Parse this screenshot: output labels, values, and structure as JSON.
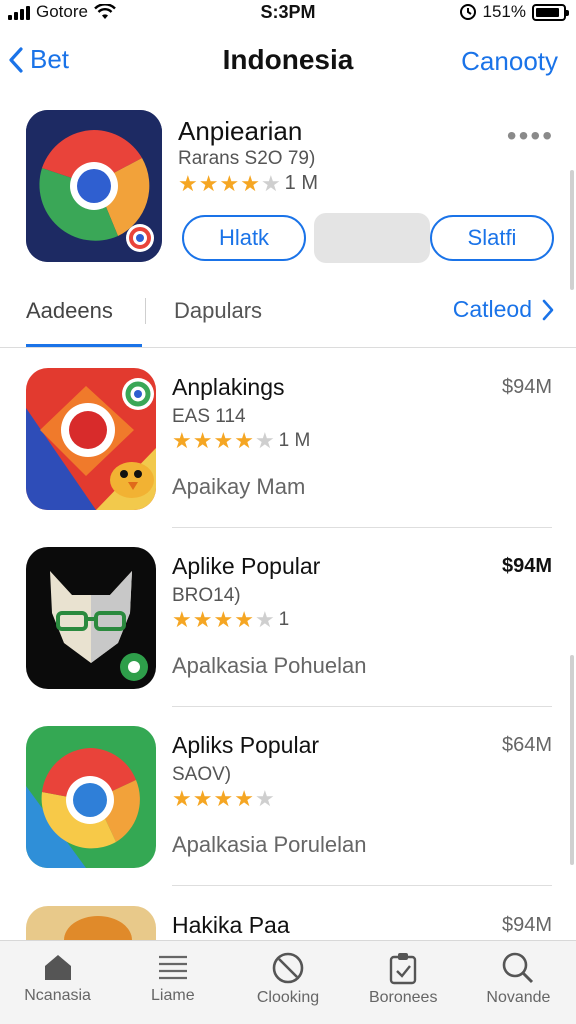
{
  "status_bar": {
    "carrier": "Gotore",
    "time": "S:3PM",
    "battery_text": "151%",
    "battery_level": 0.9
  },
  "nav": {
    "back_label": "Bet",
    "title": "Indonesia",
    "action_label": "Canooty"
  },
  "featured": {
    "name": "Anpiearian",
    "subtitle": "Rarans S2O 79)",
    "rating_stars": 4,
    "rating_count": "1 M",
    "more_label": "••••",
    "button_left": "Hlatk",
    "button_right": "Slatfi"
  },
  "segment": {
    "tab1": "Aadeens",
    "tab2": "Dapulars",
    "tab3": "Catleod"
  },
  "apps": [
    {
      "name": "Anplakings",
      "subtitle": "EAS 114",
      "rating_stars": 4,
      "rating_count": "1 M",
      "description": "Apaikay Mam",
      "price": "$94M"
    },
    {
      "name": "Aplike Popular",
      "subtitle": "BRO14)",
      "rating_stars": 4,
      "rating_count": "1",
      "description": "Apalkasia Pohuelan",
      "price": "$94M"
    },
    {
      "name": "Apliks Popular",
      "subtitle": "SAOV)",
      "rating_stars": 4,
      "rating_count": "",
      "description": "Apalkasia Porulelan",
      "price": "$64M"
    },
    {
      "name": "Hakika Paa",
      "subtitle": "",
      "rating_stars": 0,
      "rating_count": "",
      "description": "",
      "price": "$94M"
    }
  ],
  "tab_bar": [
    {
      "label": "Ncanasia",
      "icon": "home-icon"
    },
    {
      "label": "Liame",
      "icon": "list-icon"
    },
    {
      "label": "Clooking",
      "icon": "no-entry-icon"
    },
    {
      "label": "Boronees",
      "icon": "clipboard-icon"
    },
    {
      "label": "Novande",
      "icon": "search-icon"
    }
  ],
  "colors": {
    "accent": "#1a73e8",
    "star": "#f5a623"
  }
}
